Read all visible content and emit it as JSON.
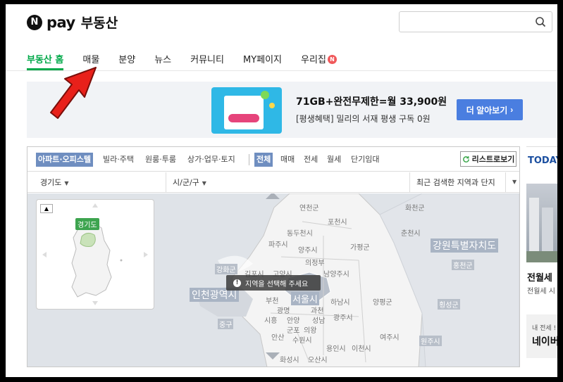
{
  "header": {
    "logo_badge": "N",
    "logo_pay": "pay",
    "logo_name": "부동산",
    "search_placeholder": ""
  },
  "nav": {
    "items": [
      {
        "label": "부동산 홈",
        "active": true
      },
      {
        "label": "매물",
        "active": false
      },
      {
        "label": "분양",
        "active": false
      },
      {
        "label": "뉴스",
        "active": false
      },
      {
        "label": "커뮤니티",
        "active": false
      },
      {
        "label": "MY페이지",
        "active": false
      },
      {
        "label": "우리집",
        "active": false
      }
    ],
    "new_badge": "N"
  },
  "banner": {
    "title": "71GB+완전무제한=월 33,900원",
    "subtitle": "[평생혜택] 밀리의 서재 평생 구독 0원",
    "button": "더 알아보기",
    "button_chevron": "›"
  },
  "filters": {
    "property_types": [
      "아파트·오피스텔",
      "빌라·주택",
      "원룸·투룸",
      "상가·업무·토지"
    ],
    "deal_types": [
      "전체",
      "매매",
      "전세",
      "월세",
      "단기임대"
    ],
    "list_button": "리스트로보기"
  },
  "selectors": {
    "province": "경기도",
    "city": "시/군/구",
    "recent": "최근 검색한 지역과 단지"
  },
  "map": {
    "mini_tag": "경기도",
    "toast": "지역을 선택해 주세요",
    "labels": [
      {
        "text": "화천군"
      },
      {
        "text": "연천군"
      },
      {
        "text": "포천시"
      },
      {
        "text": "동두천시"
      },
      {
        "text": "춘천시"
      },
      {
        "text": "파주시"
      },
      {
        "text": "양주시"
      },
      {
        "text": "가평군"
      },
      {
        "text": "강원특별자치도"
      },
      {
        "text": "의정부"
      },
      {
        "text": "홍천군"
      },
      {
        "text": "강화군"
      },
      {
        "text": "김포시"
      },
      {
        "text": "고양시"
      },
      {
        "text": "남양주시"
      },
      {
        "text": "인천광역시"
      },
      {
        "text": "부천"
      },
      {
        "text": "서울시"
      },
      {
        "text": "하남시"
      },
      {
        "text": "양평군"
      },
      {
        "text": "횡성군"
      },
      {
        "text": "중구"
      },
      {
        "text": "광명"
      },
      {
        "text": "과천"
      },
      {
        "text": "광주시"
      },
      {
        "text": "시흥"
      },
      {
        "text": "안양"
      },
      {
        "text": "성남"
      },
      {
        "text": "군포"
      },
      {
        "text": "의왕"
      },
      {
        "text": "안산"
      },
      {
        "text": "수원시"
      },
      {
        "text": "여주시"
      },
      {
        "text": "원주시"
      },
      {
        "text": "용인시"
      },
      {
        "text": "이천시"
      },
      {
        "text": "화성시"
      },
      {
        "text": "오산시"
      }
    ]
  },
  "today": {
    "title": "TODAY",
    "headline": "전월세",
    "sub": "전월세 시",
    "box_a": "내 전세 !",
    "box_b": "네이버"
  },
  "colors": {
    "brand_green": "#03a94a",
    "accent_blue": "#4a7ee0",
    "chip_active": "#6f8ec0",
    "pointer_red": "#e8201a"
  }
}
